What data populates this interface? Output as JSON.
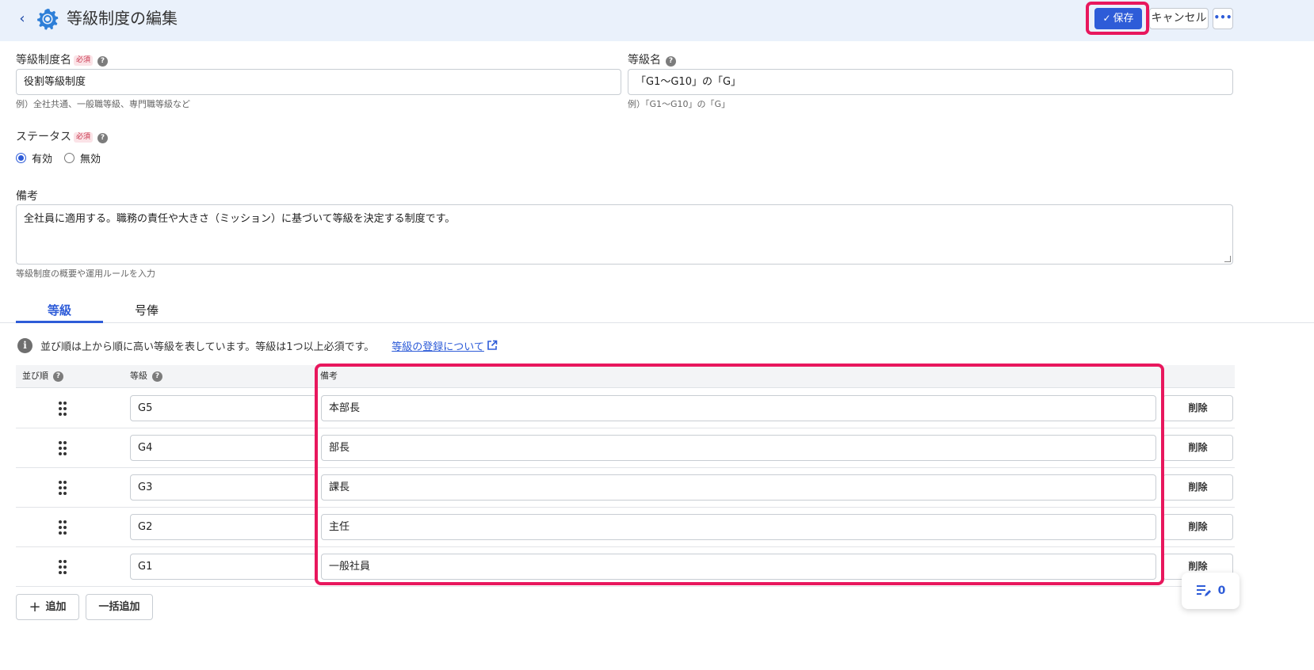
{
  "header": {
    "back_label": "‹",
    "title": "等級制度の編集",
    "save_label": "保存",
    "cancel_label": "キャンセル",
    "more_label": "•••"
  },
  "form": {
    "grade_system_name": {
      "label": "等級制度名",
      "required_badge": "必須",
      "value": "役割等級制度",
      "hint": "例）全社共通、一般職等級、専門職等級など"
    },
    "grade_name": {
      "label": "等級名",
      "value": "「G1〜G10」の「G」",
      "hint": "例）「G1〜G10」の「G」"
    },
    "status": {
      "label": "ステータス",
      "required_badge": "必須",
      "options": [
        "有効",
        "無効"
      ],
      "selected": "有効"
    },
    "notes": {
      "label": "備考",
      "value": "全社員に適用する。職務の責任や大きさ（ミッション）に基づいて等級を決定する制度です。",
      "hint": "等級制度の概要や運用ルールを入力"
    }
  },
  "tabs": [
    {
      "label": "等級",
      "active": true
    },
    {
      "label": "号俸",
      "active": false
    }
  ],
  "info": {
    "text": "並び順は上から順に高い等級を表しています。等級は1つ以上必須です。",
    "link_text": "等級の登録について"
  },
  "table": {
    "columns": [
      "並び順",
      "等級",
      "備考"
    ],
    "rows": [
      {
        "grade": "G5",
        "note": "本部長",
        "delete": "削除"
      },
      {
        "grade": "G4",
        "note": "部長",
        "delete": "削除"
      },
      {
        "grade": "G3",
        "note": "課長",
        "delete": "削除"
      },
      {
        "grade": "G2",
        "note": "主任",
        "delete": "削除"
      },
      {
        "grade": "G1",
        "note": "一般社員",
        "delete": "削除"
      }
    ]
  },
  "actions": {
    "add_label": "追加",
    "bulk_add_label": "一括追加"
  },
  "fab": {
    "count": "0"
  },
  "colors": {
    "accent": "#2e5cd8",
    "highlight": "#e8175d",
    "header_bg": "#eaf1fb"
  }
}
